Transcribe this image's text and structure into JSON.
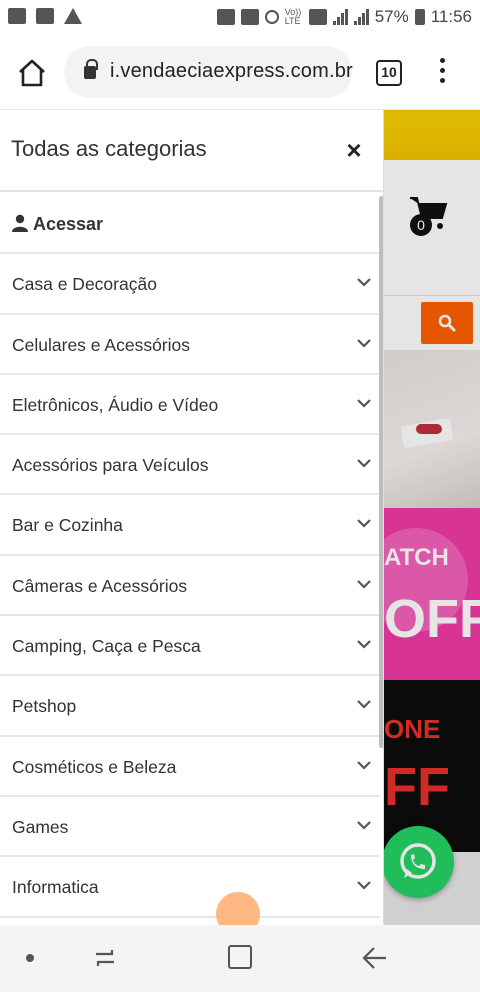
{
  "status_bar": {
    "battery": "57%",
    "time": "11:56",
    "volte": "Vo)) LTE"
  },
  "browser": {
    "url": "i.vendaeciaexpress.com.br",
    "tab_count": "10"
  },
  "background_page": {
    "cart_count": "0",
    "banner2_text": [
      "ATCH",
      "OFF"
    ],
    "banner3_text": [
      "ONE",
      "FF"
    ],
    "colors": {
      "yellow": "#f7d100",
      "orange": "#ff6000",
      "pink": "#f03aa6",
      "whatsapp": "#25d366"
    }
  },
  "drawer": {
    "title": "Todas as categorias",
    "close_symbol": "×",
    "access_label": "Acessar",
    "categories": [
      "Casa e Decoração",
      "Celulares e Acessórios",
      "Eletrônicos, Áudio e Vídeo",
      "Acessórios para Veículos",
      "Bar e Cozinha",
      "Câmeras e Acessórios",
      "Camping, Caça e Pesca",
      "Petshop",
      "Cosméticos e Beleza",
      "Games",
      "Informatica"
    ]
  },
  "icons": [
    "home-icon",
    "lock-icon",
    "tabs-icon",
    "menu-icon",
    "user-icon",
    "chevron-down-icon",
    "close-icon",
    "cart-icon",
    "search-icon",
    "whatsapp-icon"
  ]
}
